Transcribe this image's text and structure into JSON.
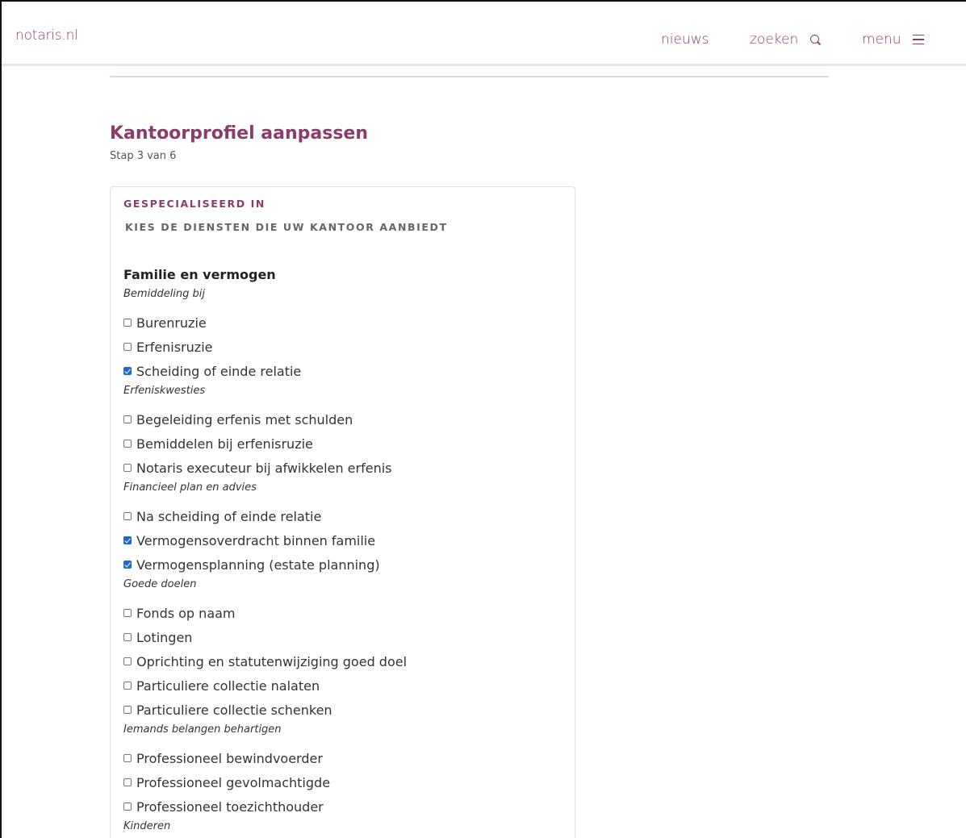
{
  "header": {
    "logo": "notaris.nl",
    "nav": {
      "news": "nieuws",
      "search": "zoeken",
      "menu": "menu"
    }
  },
  "page": {
    "title": "Kantoorprofiel aanpassen",
    "step": "Stap 3 van 6"
  },
  "form": {
    "heading": "GESPECIALISEERD IN",
    "subheading": "KIES DE DIENSTEN DIE UW KANTOOR AANBIEDT",
    "group_title": "Familie en vermogen",
    "sections": [
      {
        "label": "Bemiddeling bij",
        "options": [
          {
            "label": "Burenruzie",
            "checked": false
          },
          {
            "label": "Erfenisruzie",
            "checked": false
          },
          {
            "label": "Scheiding of einde relatie",
            "checked": true
          }
        ]
      },
      {
        "label": "Erfeniskwesties",
        "options": [
          {
            "label": "Begeleiding erfenis met schulden",
            "checked": false
          },
          {
            "label": "Bemiddelen bij erfenisruzie",
            "checked": false
          },
          {
            "label": "Notaris executeur bij afwikkelen erfenis",
            "checked": false
          }
        ]
      },
      {
        "label": "Financieel plan en advies",
        "options": [
          {
            "label": "Na scheiding of einde relatie",
            "checked": false
          },
          {
            "label": "Vermogensoverdracht binnen familie",
            "checked": true
          },
          {
            "label": "Vermogensplanning (estate planning)",
            "checked": true
          }
        ]
      },
      {
        "label": "Goede doelen",
        "options": [
          {
            "label": "Fonds op naam",
            "checked": false
          },
          {
            "label": "Lotingen",
            "checked": false
          },
          {
            "label": "Oprichting en statutenwijziging goed doel",
            "checked": false
          },
          {
            "label": "Particuliere collectie nalaten",
            "checked": false
          },
          {
            "label": "Particuliere collectie schenken",
            "checked": false
          }
        ]
      },
      {
        "label": "Iemands belangen behartigen",
        "options": [
          {
            "label": "Professioneel bewindvoerder",
            "checked": false
          },
          {
            "label": "Professioneel gevolmachtigde",
            "checked": false
          },
          {
            "label": "Professioneel toezichthouder",
            "checked": false
          }
        ]
      },
      {
        "label": "Kinderen",
        "options": []
      }
    ]
  },
  "colors": {
    "brand": "#8a3d6c",
    "checkbox_checked": "#1a66d2"
  }
}
